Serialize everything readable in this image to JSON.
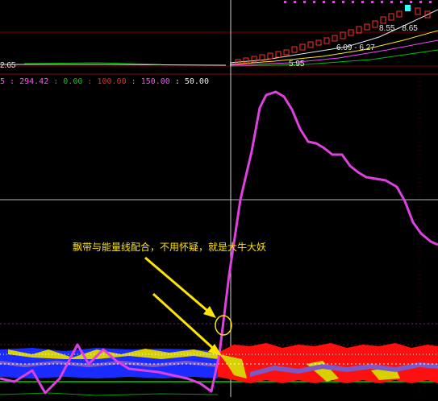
{
  "top_panel": {
    "left_edge_value": "2.65",
    "price_label_1": "8.55 - 8.65",
    "price_label_2": "6.09 - 6.27",
    "price_label_3": "5.95"
  },
  "indicator_legend": {
    "prefix": "5 :",
    "value_1": "294.42",
    "value_2": "0.00",
    "value_3": "100.00",
    "value_4": "150.00",
    "value_5": "50.00",
    "color_1": "#ff55ff",
    "color_2": "#00d000",
    "color_3": "#ff2020",
    "color_4": "#ff44ff",
    "color_5": "#e8e8e8"
  },
  "annotation": {
    "text": "飘带与能量线配合，不用怀疑，就是大牛大妖",
    "color": "#ffe400"
  },
  "colors": {
    "energy_line": "#e040e0",
    "band_blue": "#1a2cff",
    "band_red": "#ff1010",
    "band_yellow": "#d8d000",
    "band_purple": "#7a5ac8",
    "guide_green": "#00cc00",
    "grid": "#7a0000",
    "crosshair": "#cfcfcf"
  }
}
